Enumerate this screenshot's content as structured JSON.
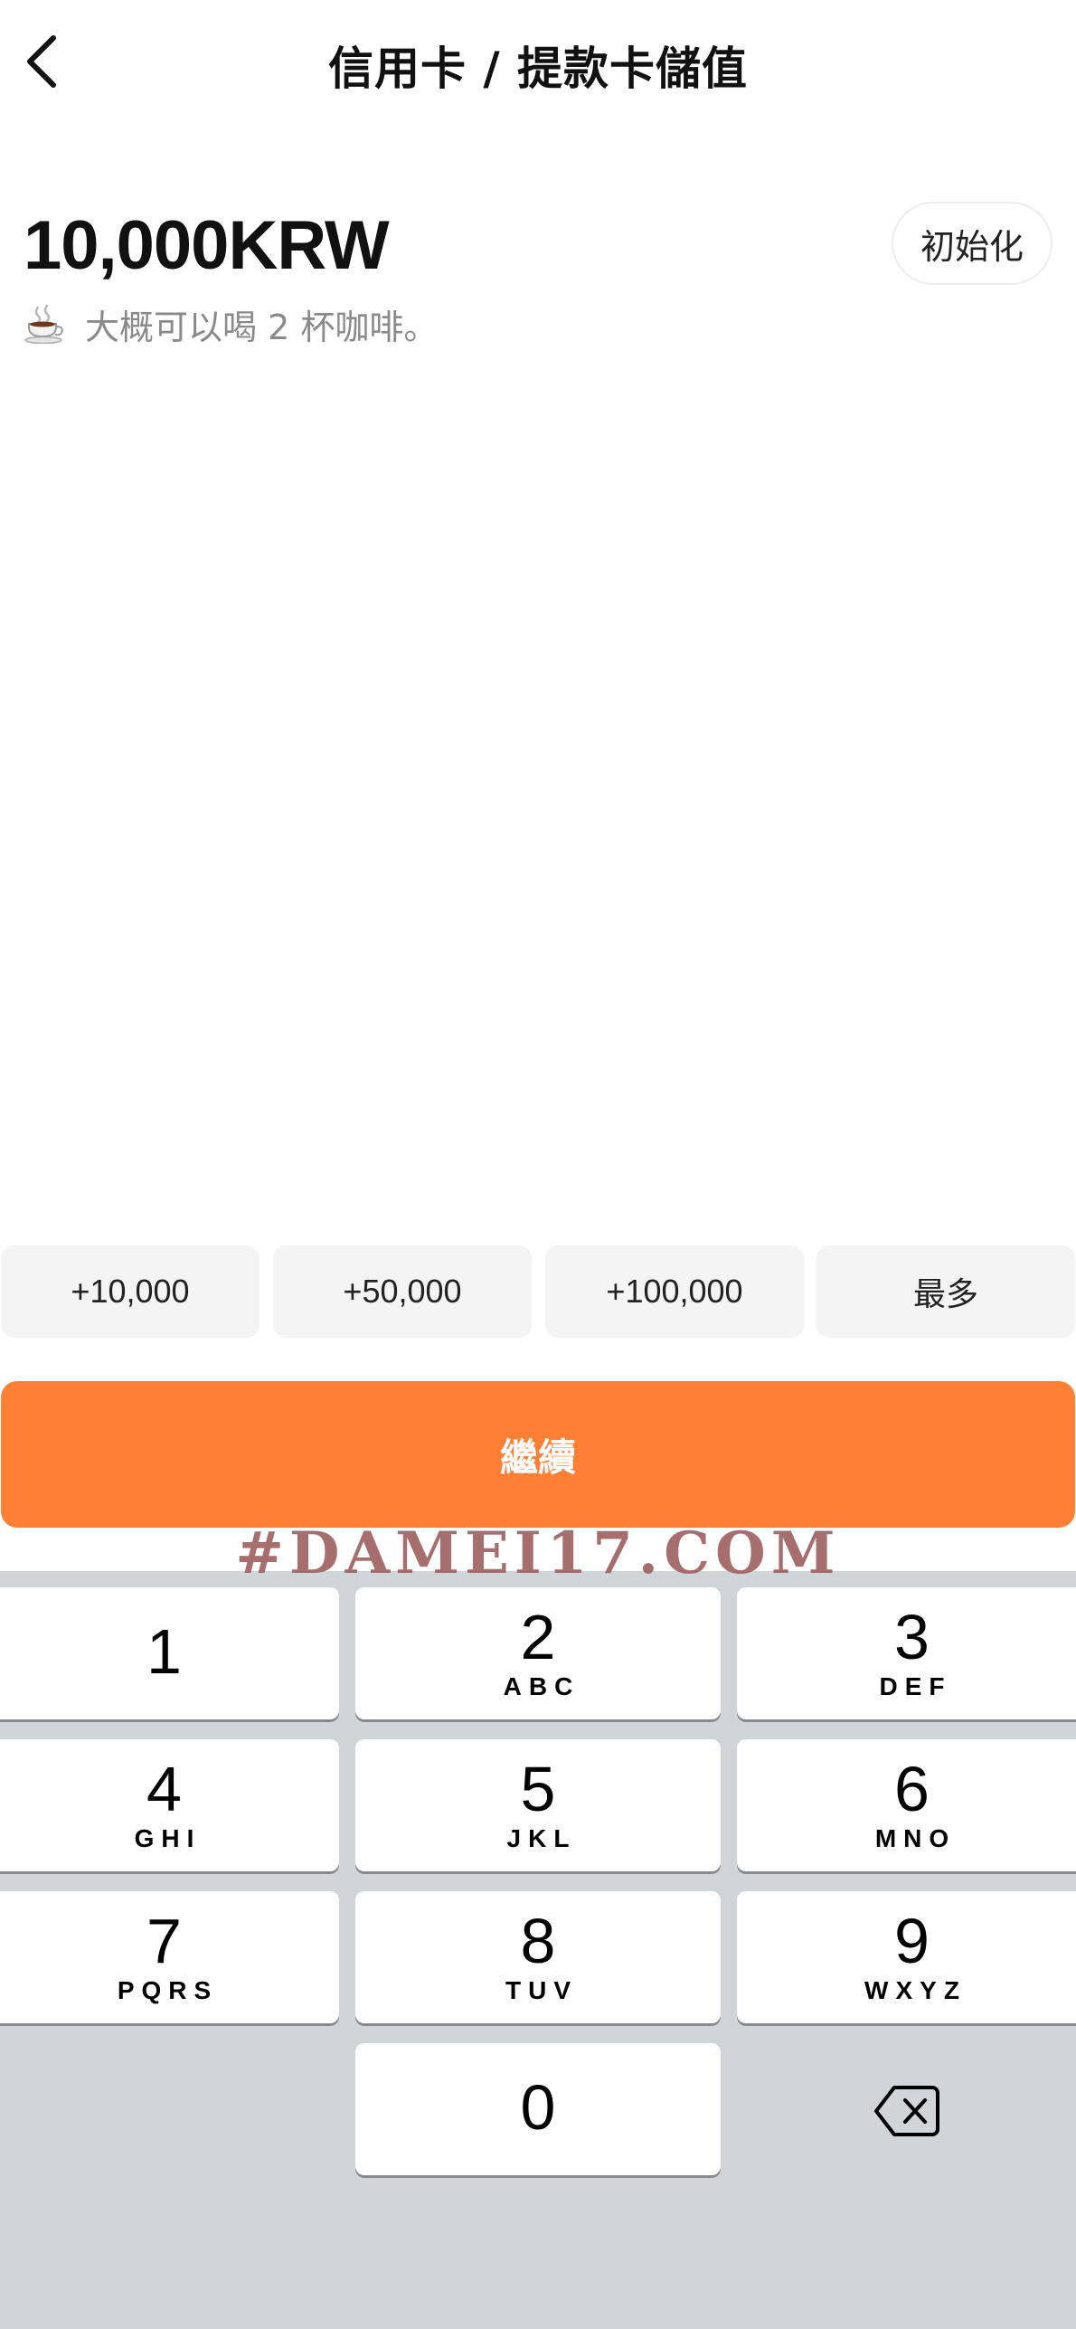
{
  "header": {
    "title": "信用卡 / 提款卡儲值",
    "back_icon": "chevron-left-icon"
  },
  "amount": {
    "value": "10,000KRW",
    "reset_label": "初始化",
    "hint_icon": "coffee-cup-icon",
    "hint_text": "大概可以喝 2 杯咖啡。"
  },
  "quick_add": [
    {
      "label": "+10,000"
    },
    {
      "label": "+50,000"
    },
    {
      "label": "+100,000"
    },
    {
      "label": "最多"
    }
  ],
  "continue_label": "繼續",
  "watermark": "#DAMEI17.COM",
  "keypad": {
    "keys": [
      {
        "num": "1",
        "letters": ""
      },
      {
        "num": "2",
        "letters": "ABC"
      },
      {
        "num": "3",
        "letters": "DEF"
      },
      {
        "num": "4",
        "letters": "GHI"
      },
      {
        "num": "5",
        "letters": "JKL"
      },
      {
        "num": "6",
        "letters": "MNO"
      },
      {
        "num": "7",
        "letters": "PQRS"
      },
      {
        "num": "8",
        "letters": "TUV"
      },
      {
        "num": "9",
        "letters": "WXYZ"
      },
      {
        "num": "0",
        "letters": ""
      }
    ],
    "delete_icon": "backspace-icon"
  },
  "colors": {
    "accent": "#ff8034",
    "keypad_bg": "#d1d4d9",
    "chip_bg": "#f4f4f4",
    "hint_text": "#8a8a8a"
  }
}
